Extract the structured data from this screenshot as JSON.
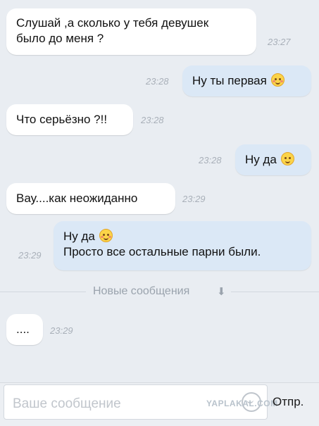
{
  "messages": [
    {
      "direction": "incoming",
      "lines": [
        "Слушай ,а сколько у тебя девушек",
        "было до меня ?"
      ],
      "time": "23:27"
    },
    {
      "direction": "outgoing",
      "text": "Ну ты первая",
      "emoji": "smiling-blush-emoji",
      "time": "23:28"
    },
    {
      "direction": "incoming",
      "text": "Что серьёзно ?!!",
      "time": "23:28"
    },
    {
      "direction": "outgoing",
      "text": "Ну да",
      "emoji": "smile-emoji",
      "time": "23:28"
    },
    {
      "direction": "incoming",
      "text": "Вау....как неожиданно",
      "time": "23:29"
    },
    {
      "direction": "outgoing",
      "lines": [
        "Ну да",
        "Просто все остальные парни были."
      ],
      "emoji": "smiling-blush-emoji",
      "time": "23:29"
    },
    {
      "direction": "incoming",
      "text": "....",
      "time": "23:29"
    }
  ],
  "divider": {
    "label": "Новые сообщения",
    "icon": "arrow-down-icon"
  },
  "composer": {
    "placeholder": "Ваше сообщение",
    "send_label": "Отпр.",
    "icon": "sticker-icon",
    "watermark": "YAPLAKAL.COM"
  },
  "colors": {
    "background": "#e9edf2",
    "incoming_bubble": "#ffffff",
    "outgoing_bubble": "#dbe8f6",
    "timestamp": "#a9b0b9"
  }
}
